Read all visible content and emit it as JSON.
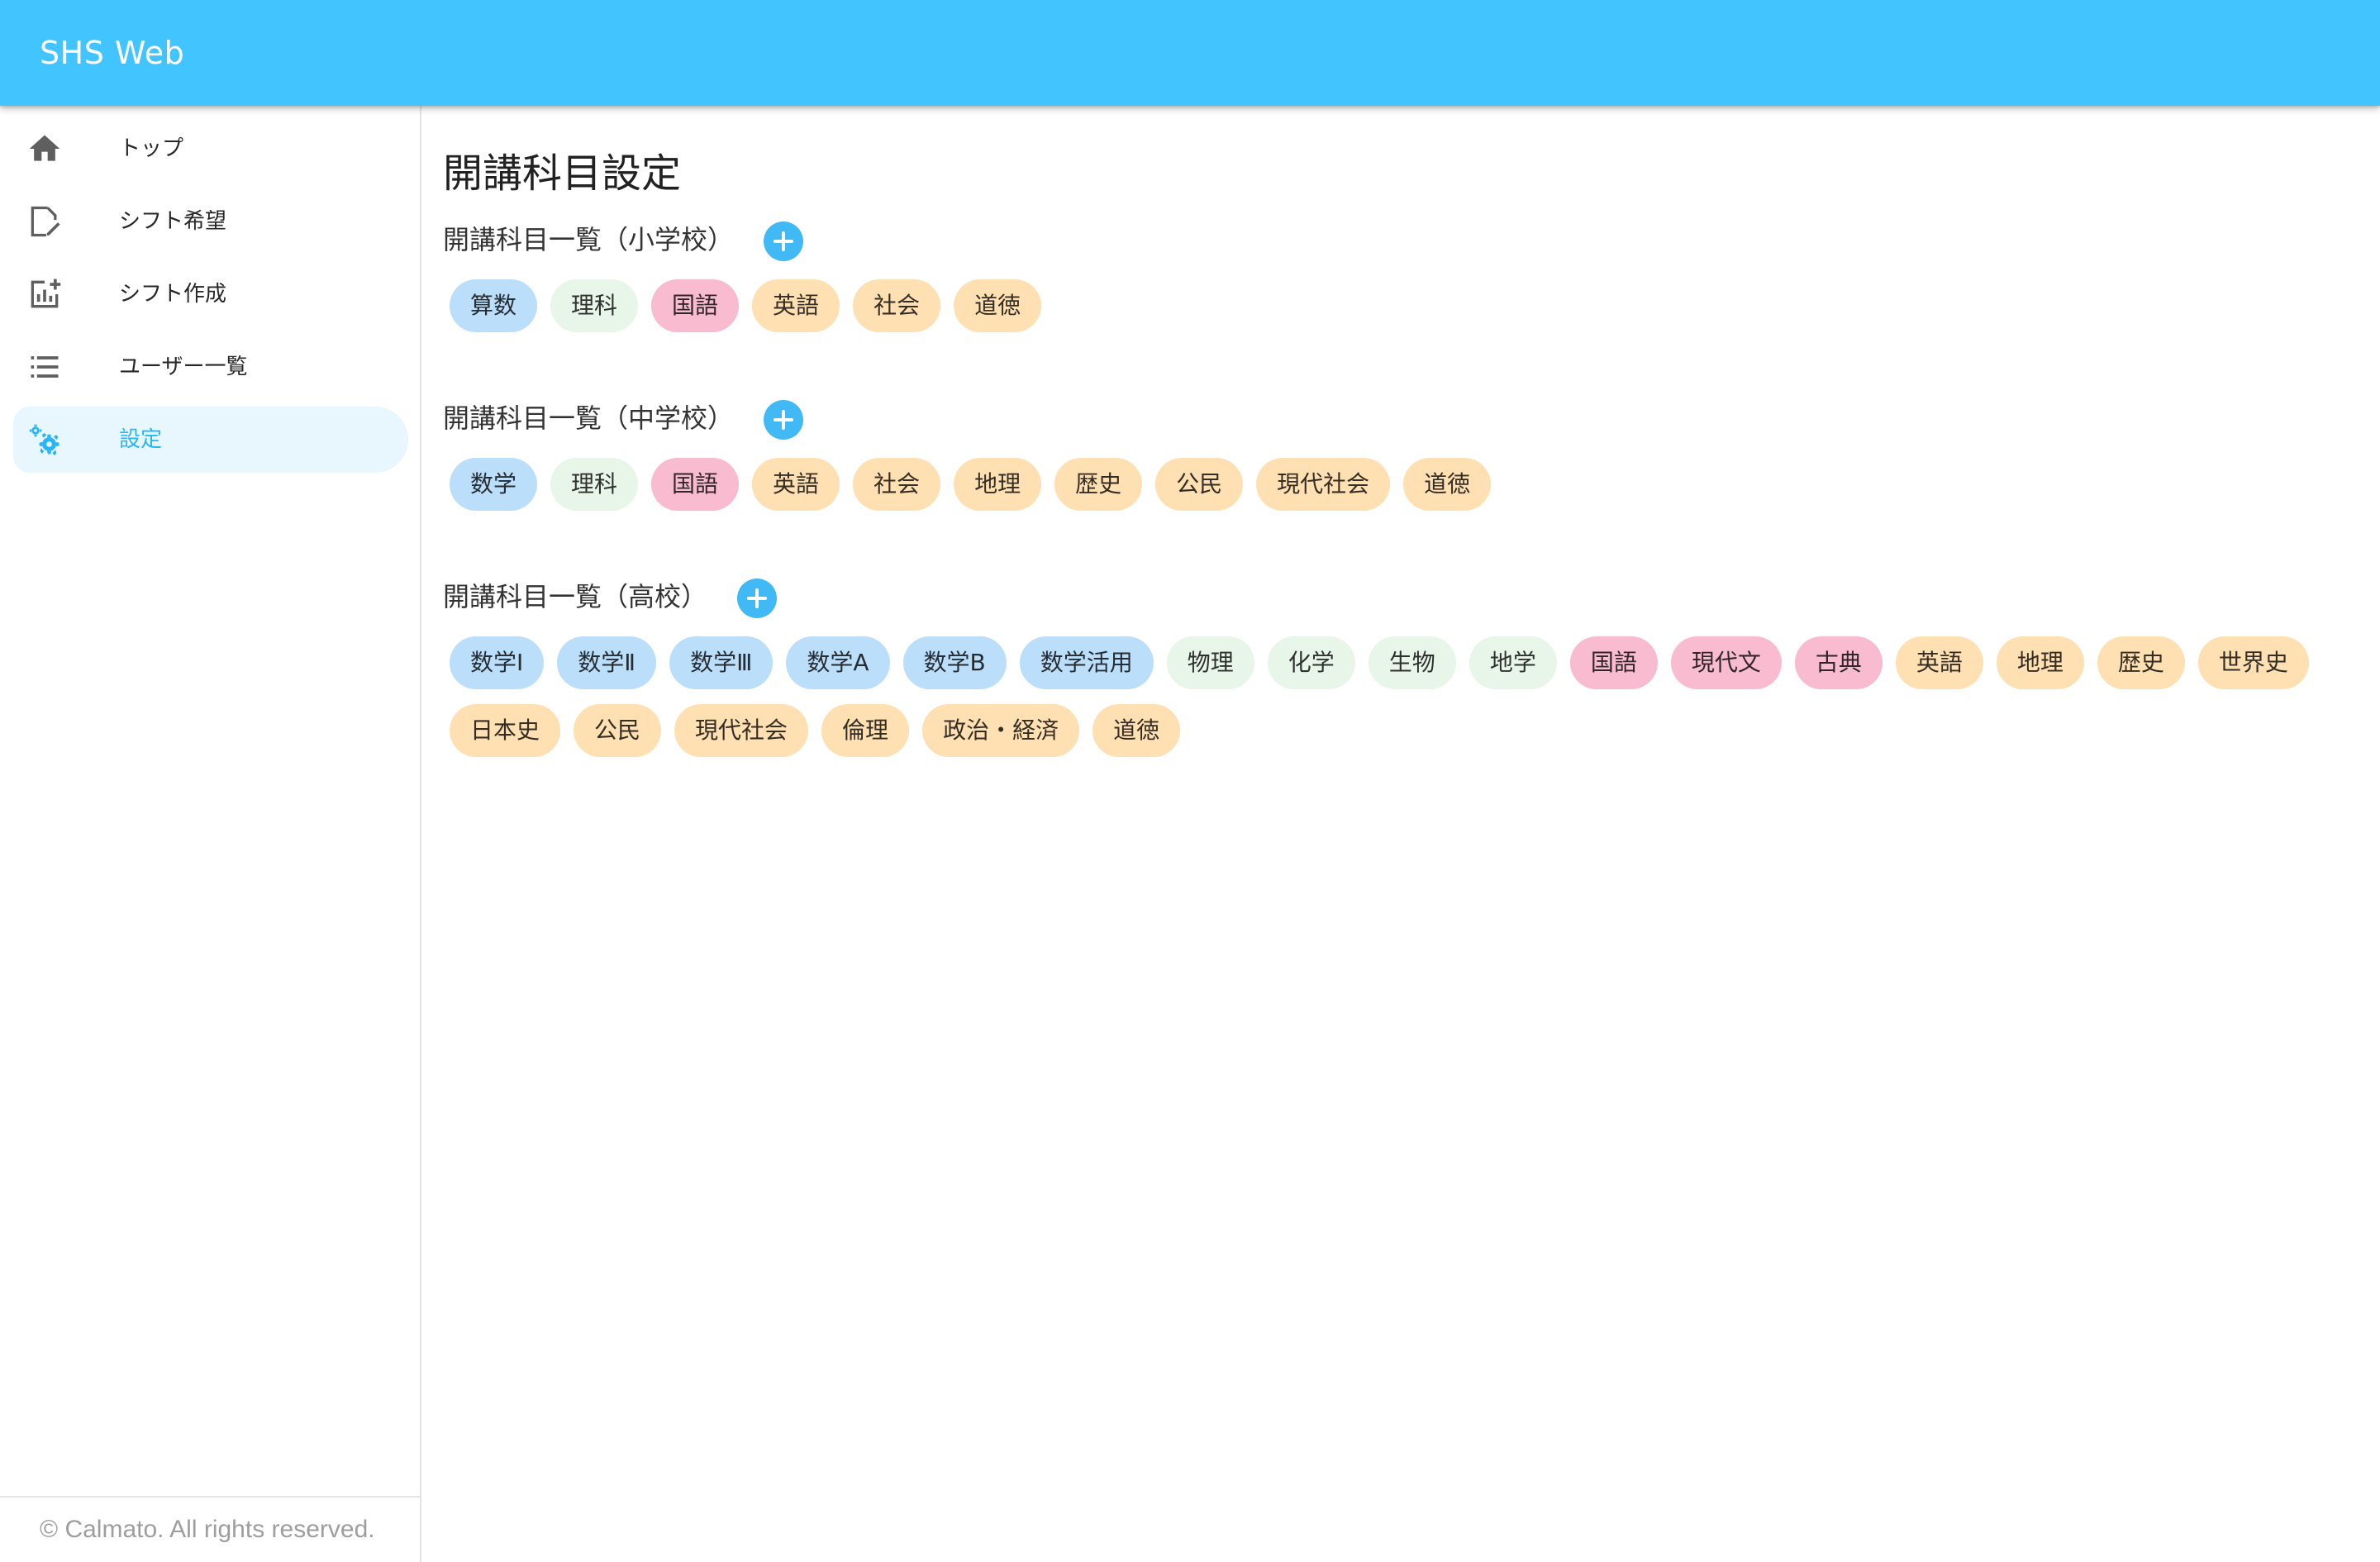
{
  "app": {
    "title": "SHS Web"
  },
  "sidebar": {
    "items": [
      {
        "label": "トップ",
        "icon": "home-icon",
        "active": false
      },
      {
        "label": "シフト希望",
        "icon": "edit-note-icon",
        "active": false
      },
      {
        "label": "シフト作成",
        "icon": "add-chart-icon",
        "active": false
      },
      {
        "label": "ユーザー一覧",
        "icon": "list-icon",
        "active": false
      },
      {
        "label": "設定",
        "icon": "settings-gears-icon",
        "active": true
      }
    ],
    "footer": "© Calmato. All rights reserved."
  },
  "colors": {
    "appbar": "#41c4ff",
    "accent": "#29b6f6",
    "add_button": "#41b9f5",
    "chip_blue": "#bbdefb",
    "chip_green": "#e8f5e9",
    "chip_pink": "#f8bbd0",
    "chip_orange": "#ffe0b2"
  },
  "main": {
    "title": "開講科目設定",
    "sections": [
      {
        "title": "開講科目一覧（小学校）",
        "subjects": [
          {
            "name": "算数",
            "color": "blue"
          },
          {
            "name": "理科",
            "color": "green"
          },
          {
            "name": "国語",
            "color": "pink"
          },
          {
            "name": "英語",
            "color": "peach"
          },
          {
            "name": "社会",
            "color": "orange"
          },
          {
            "name": "道徳",
            "color": "orange"
          }
        ]
      },
      {
        "title": "開講科目一覧（中学校）",
        "subjects": [
          {
            "name": "数学",
            "color": "blue"
          },
          {
            "name": "理科",
            "color": "green"
          },
          {
            "name": "国語",
            "color": "pink"
          },
          {
            "name": "英語",
            "color": "peach"
          },
          {
            "name": "社会",
            "color": "orange"
          },
          {
            "name": "地理",
            "color": "orange"
          },
          {
            "name": "歴史",
            "color": "orange"
          },
          {
            "name": "公民",
            "color": "orange"
          },
          {
            "name": "現代社会",
            "color": "orange"
          },
          {
            "name": "道徳",
            "color": "orange"
          }
        ]
      },
      {
        "title": "開講科目一覧（高校）",
        "subjects": [
          {
            "name": "数学Ⅰ",
            "color": "blue"
          },
          {
            "name": "数学Ⅱ",
            "color": "blue"
          },
          {
            "name": "数学Ⅲ",
            "color": "blue"
          },
          {
            "name": "数学A",
            "color": "blue"
          },
          {
            "name": "数学B",
            "color": "blue"
          },
          {
            "name": "数学活用",
            "color": "blue"
          },
          {
            "name": "物理",
            "color": "green"
          },
          {
            "name": "化学",
            "color": "green"
          },
          {
            "name": "生物",
            "color": "green"
          },
          {
            "name": "地学",
            "color": "green"
          },
          {
            "name": "国語",
            "color": "pink"
          },
          {
            "name": "現代文",
            "color": "pink"
          },
          {
            "name": "古典",
            "color": "pink"
          },
          {
            "name": "英語",
            "color": "peach"
          },
          {
            "name": "地理",
            "color": "orange"
          },
          {
            "name": "歴史",
            "color": "orange"
          },
          {
            "name": "世界史",
            "color": "orange"
          },
          {
            "name": "日本史",
            "color": "orange"
          },
          {
            "name": "公民",
            "color": "orange"
          },
          {
            "name": "現代社会",
            "color": "orange"
          },
          {
            "name": "倫理",
            "color": "orange"
          },
          {
            "name": "政治・経済",
            "color": "orange"
          },
          {
            "name": "道徳",
            "color": "orange"
          }
        ]
      }
    ]
  }
}
